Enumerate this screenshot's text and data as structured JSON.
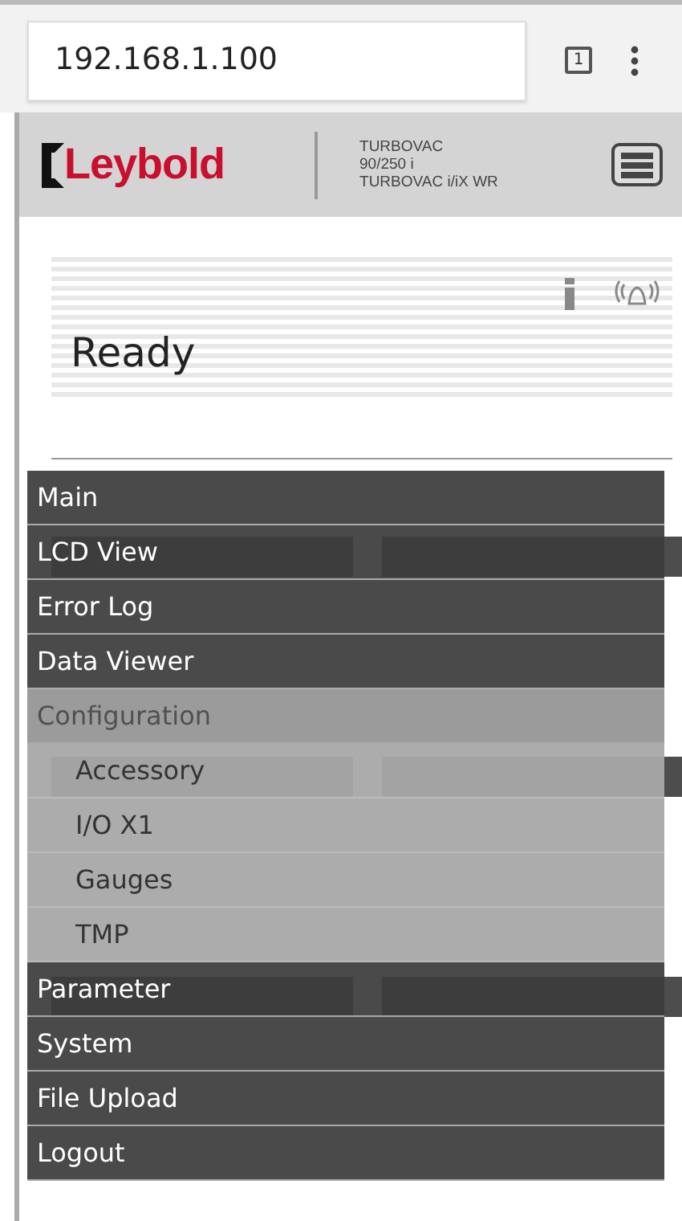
{
  "browser": {
    "address": "192.168.1.100",
    "tab_count": "1"
  },
  "header": {
    "logo": "Leybold",
    "model_lines": [
      "TURBOVAC",
      "90/250 i",
      "TURBOVAC i/iX WR"
    ]
  },
  "status": {
    "text": "Ready"
  },
  "menu": {
    "items": [
      {
        "label": "Main"
      },
      {
        "label": "LCD View"
      },
      {
        "label": "Error Log"
      },
      {
        "label": "Data Viewer"
      },
      {
        "label": "Configuration",
        "expanded": true,
        "children": [
          {
            "label": "Accessory"
          },
          {
            "label": "I/O X1"
          },
          {
            "label": "Gauges"
          },
          {
            "label": "TMP"
          }
        ]
      },
      {
        "label": "Parameter"
      },
      {
        "label": "System"
      },
      {
        "label": "File Upload"
      },
      {
        "label": "Logout"
      }
    ]
  }
}
